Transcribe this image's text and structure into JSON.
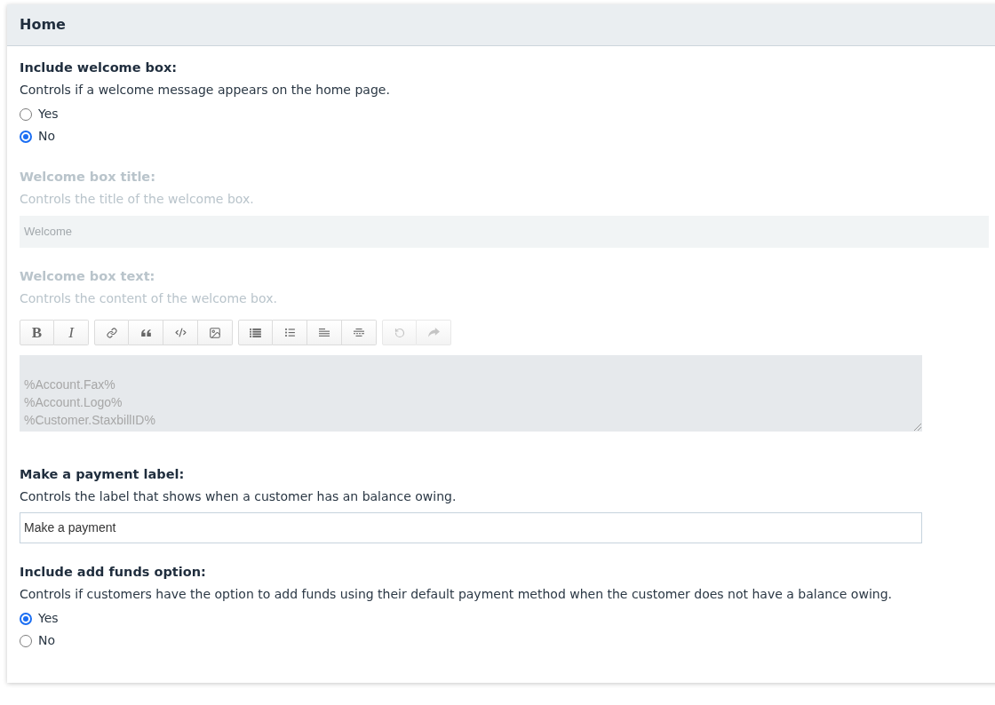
{
  "panel": {
    "title": "Home"
  },
  "settings": [
    {
      "kind": "radio",
      "label": "Include welcome box:",
      "description": "Controls if a welcome message appears on the home page.",
      "disabled": false,
      "options": [
        {
          "label": "Yes",
          "selected": false
        },
        {
          "label": "No",
          "selected": true
        }
      ]
    },
    {
      "kind": "text",
      "label": "Welcome box title:",
      "description": "Controls the title of the welcome box.",
      "disabled": true,
      "value": "Welcome"
    },
    {
      "kind": "editor",
      "label": "Welcome box text:",
      "description": "Controls the content of the welcome box.",
      "disabled": true,
      "toolbar": [
        [
          {
            "kind": "bold",
            "text": "B",
            "disabled": false
          },
          {
            "kind": "italic",
            "text": "I",
            "disabled": false
          }
        ],
        [
          {
            "kind": "link",
            "disabled": false
          },
          {
            "kind": "quote",
            "disabled": false
          },
          {
            "kind": "code",
            "disabled": false
          },
          {
            "kind": "image",
            "disabled": false
          }
        ],
        [
          {
            "kind": "list",
            "disabled": false
          },
          {
            "kind": "bullet-list",
            "disabled": false
          },
          {
            "kind": "align-left",
            "disabled": false
          },
          {
            "kind": "align-center",
            "disabled": false
          }
        ],
        [
          {
            "kind": "undo",
            "disabled": true
          },
          {
            "kind": "redo",
            "disabled": true
          }
        ]
      ],
      "lines": [
        "%Account.Fax%",
        "%Account.Logo%",
        "%Customer.StaxbillID%"
      ]
    },
    {
      "kind": "text",
      "label": "Make a payment label:",
      "description": "Controls the label that shows when a customer has an balance owing.",
      "disabled": false,
      "value": "Make a payment"
    },
    {
      "kind": "radio",
      "label": "Include add funds option:",
      "description": "Controls if customers have the option to add funds using their default payment method when the customer does not have a balance owing.",
      "disabled": false,
      "options": [
        {
          "label": "Yes",
          "selected": true
        },
        {
          "label": "No",
          "selected": false
        }
      ]
    }
  ]
}
